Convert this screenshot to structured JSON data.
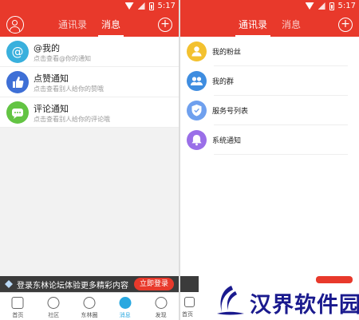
{
  "status_bar": {
    "time": "5:17"
  },
  "left_screen": {
    "tabs": [
      "通讯录",
      "消息"
    ],
    "active_tab": "消息",
    "messages": [
      {
        "title": "@我的",
        "subtitle": "点击查看@你的通知",
        "icon": "at-icon",
        "color": "#39b0dd"
      },
      {
        "title": "点赞通知",
        "subtitle": "点击查看别人给你的赞哦",
        "icon": "thumbs-up-icon",
        "color": "#3e6fd6"
      },
      {
        "title": "评论通知",
        "subtitle": "点击查看别人给你的评论哦",
        "icon": "comment-icon",
        "color": "#63c443"
      }
    ],
    "banner": {
      "text": "登录东林论坛体验更多精彩内容",
      "button": "立即登录"
    },
    "bottom_nav": [
      {
        "label": "首页",
        "icon": "home-icon",
        "active": false
      },
      {
        "label": "社区",
        "icon": "community-icon",
        "active": false
      },
      {
        "label": "东林圈",
        "icon": "circle-icon",
        "active": false
      },
      {
        "label": "消息",
        "icon": "message-icon",
        "active": true
      },
      {
        "label": "发现",
        "icon": "discover-icon",
        "active": false
      }
    ]
  },
  "right_screen": {
    "tabs": [
      "通讯录",
      "消息"
    ],
    "active_tab": "通讯录",
    "contacts": [
      {
        "label": "我的粉丝",
        "icon": "fans-icon",
        "color": "#f3c12f"
      },
      {
        "label": "我的群",
        "icon": "group-icon",
        "color": "#3f8de0"
      },
      {
        "label": "服务号列表",
        "icon": "shield-check-icon",
        "color": "#6fa0ee"
      },
      {
        "label": "系统通知",
        "icon": "bell-icon",
        "color": "#9a6fe8"
      }
    ],
    "bottom_nav_partial": "首页"
  },
  "watermark": {
    "text": "汉界软件园"
  },
  "colors": {
    "brand_red": "#e8392b",
    "accent_blue": "#29a8e0"
  }
}
